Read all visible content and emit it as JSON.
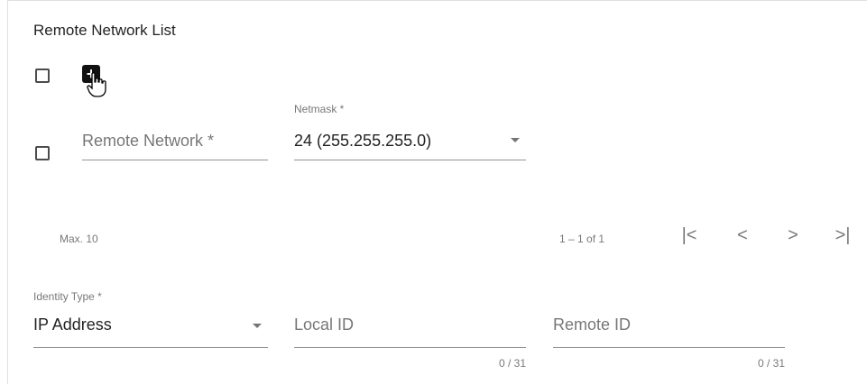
{
  "section": {
    "title": "Remote Network List"
  },
  "toolbar": {
    "add_icon_glyph": "+"
  },
  "row": {
    "remote_network_placeholder": "Remote Network *",
    "netmask_label": "Netmask *",
    "netmask_value": "24 (255.255.255.0)"
  },
  "footer": {
    "max_text": "Max. 10",
    "range_text": "1 – 1 of 1",
    "first_glyph": "|<",
    "prev_glyph": "<",
    "next_glyph": ">",
    "last_glyph": ">|"
  },
  "identity": {
    "type_label": "Identity Type *",
    "type_value": "IP Address",
    "local_id_placeholder": "Local ID",
    "local_id_counter": "0 / 31",
    "remote_id_placeholder": "Remote ID",
    "remote_id_counter": "0 / 31"
  }
}
